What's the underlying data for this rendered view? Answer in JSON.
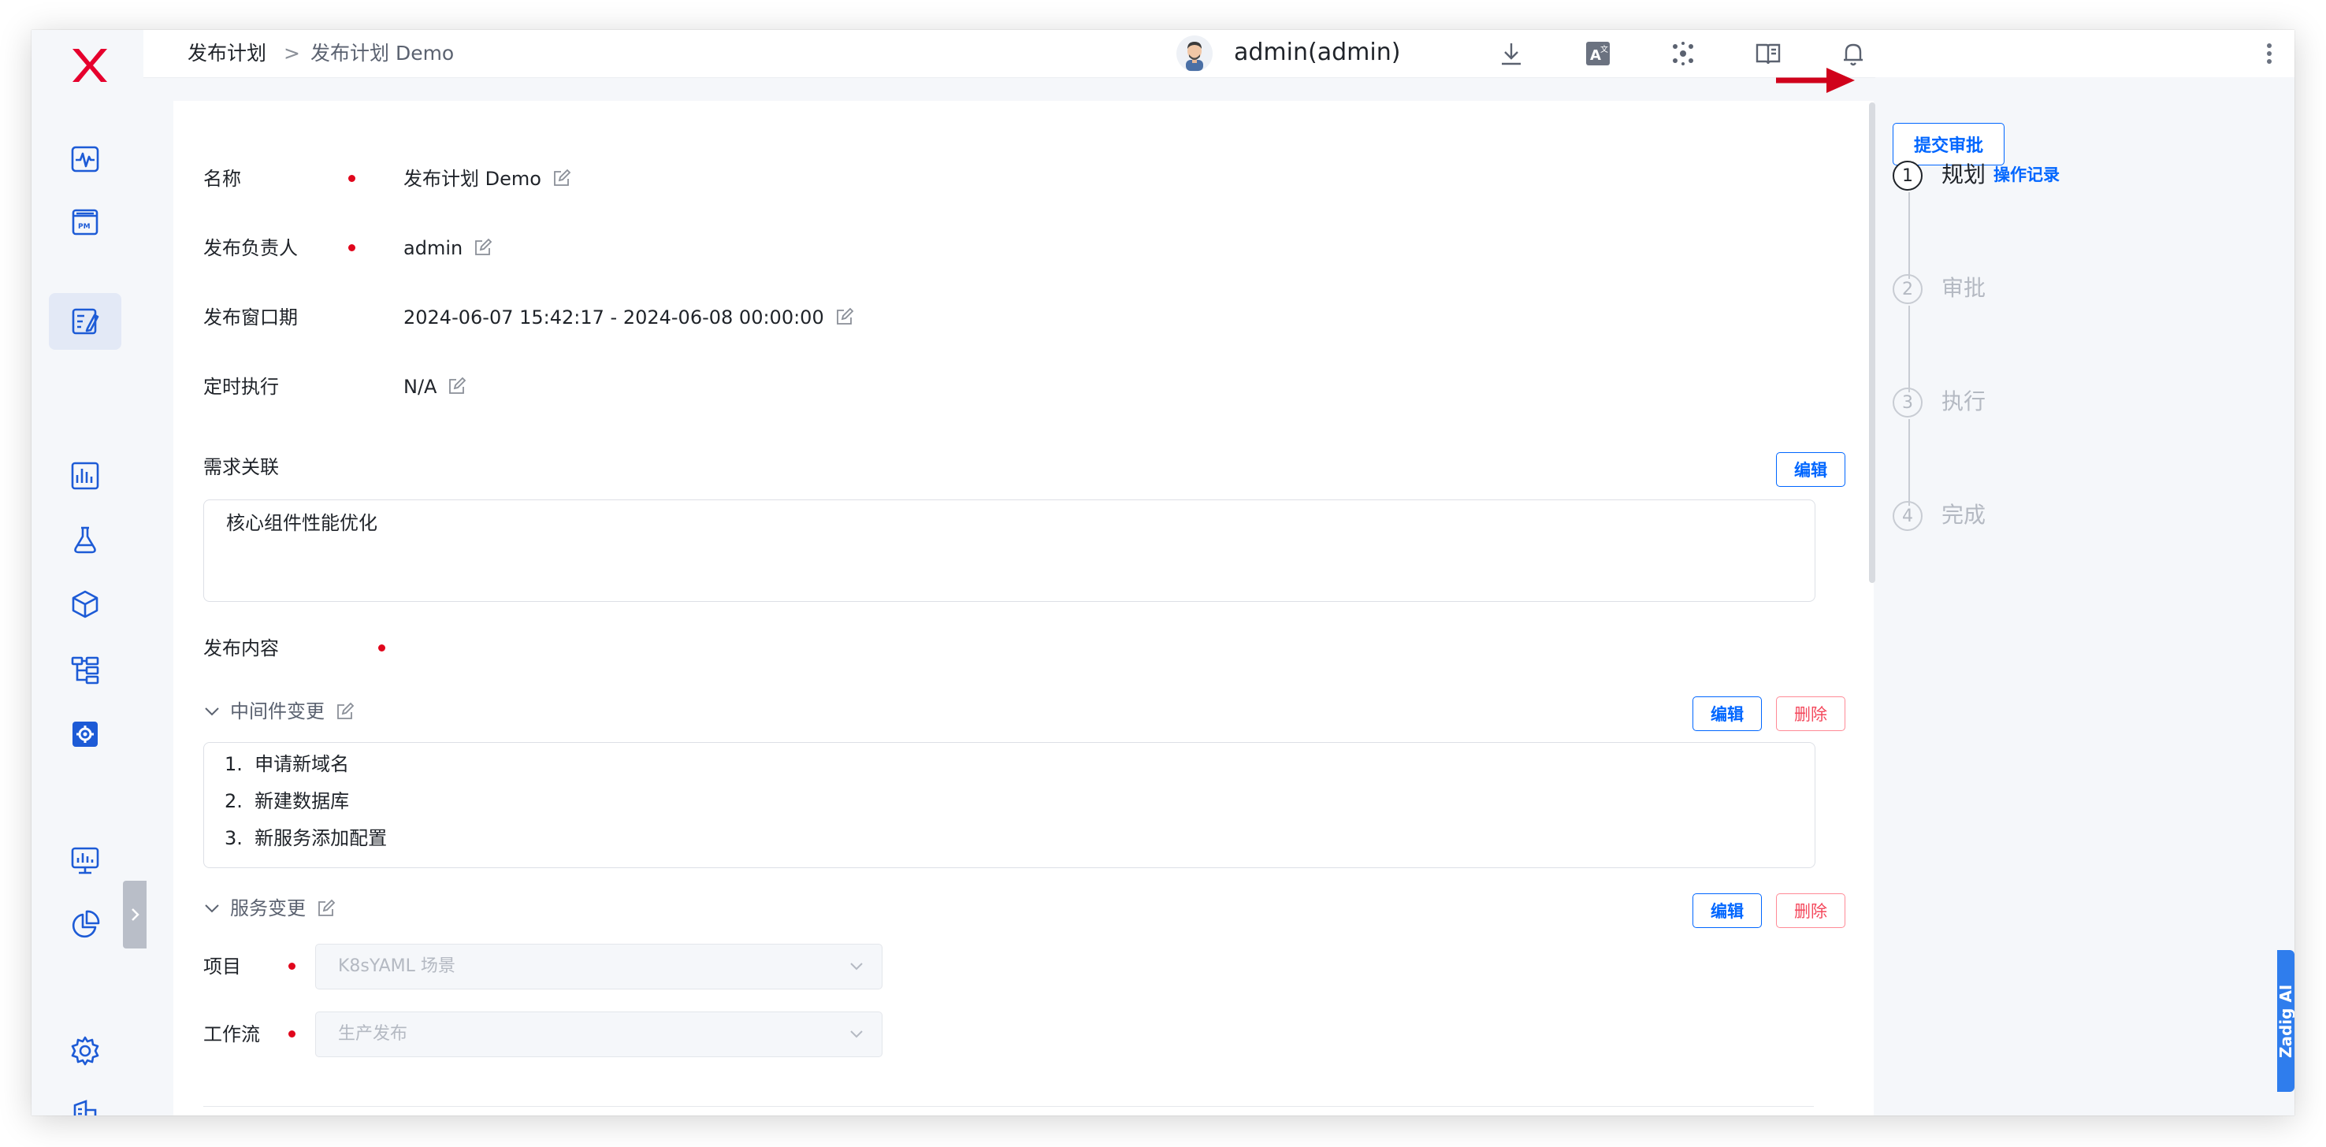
{
  "breadcrumb": {
    "root": "发布计划",
    "separator": ">",
    "current": "发布计划 Demo"
  },
  "header": {
    "user": "admin(admin)"
  },
  "form": {
    "name_label": "名称",
    "name_value": "发布计划 Demo",
    "owner_label": "发布负责人",
    "owner_value": "admin",
    "window_label": "发布窗口期",
    "window_value": "2024-06-07 15:42:17 - 2024-06-08 00:00:00",
    "schedule_label": "定时执行",
    "schedule_value": "N/A"
  },
  "requirements": {
    "label": "需求关联",
    "edit_button": "编辑",
    "content": "核心组件性能优化"
  },
  "release_content": {
    "label": "发布内容"
  },
  "middleware": {
    "title": "中间件变更",
    "edit_button": "编辑",
    "delete_button": "删除",
    "items": [
      {
        "num": "1.",
        "text": "申请新域名"
      },
      {
        "num": "2.",
        "text": "新建数据库"
      },
      {
        "num": "3.",
        "text": "新服务添加配置"
      }
    ]
  },
  "service": {
    "title": "服务变更",
    "edit_button": "编辑",
    "delete_button": "删除",
    "project_label": "项目",
    "project_value": "K8sYAML 场景",
    "workflow_label": "工作流",
    "workflow_value": "生产发布"
  },
  "approval": {
    "submit_button": "提交审批",
    "operation_log": "操作记录",
    "steps": [
      {
        "num": "1",
        "label": "规划",
        "state": "active"
      },
      {
        "num": "2",
        "label": "审批",
        "state": "idle"
      },
      {
        "num": "3",
        "label": "执行",
        "state": "idle"
      },
      {
        "num": "4",
        "label": "完成",
        "state": "idle"
      }
    ]
  },
  "assistant_tab": "Zadig AI",
  "colors": {
    "accent": "#0066ff",
    "required": "#e0061c",
    "danger": "#f4485c",
    "logo": "#e6002d",
    "arrow": "#d0021b"
  }
}
